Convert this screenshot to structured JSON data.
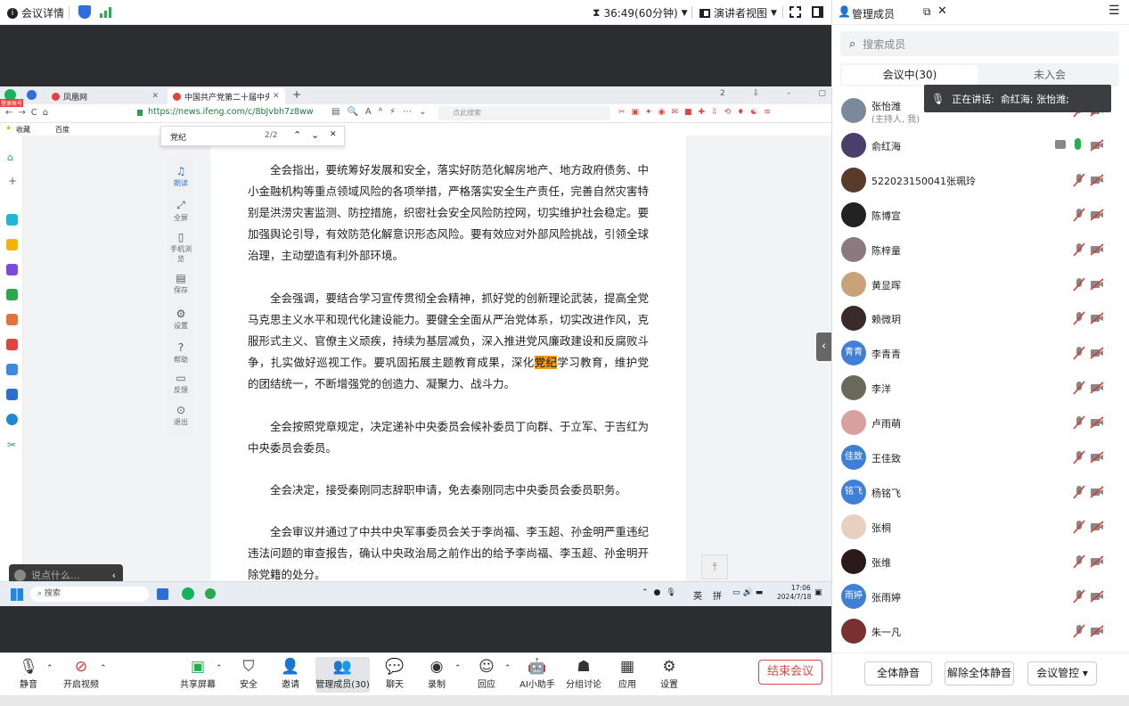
{
  "topbar": {
    "meeting_details": "会议详情",
    "timer": "36:49(60分钟)",
    "view_mode": "演讲者视图"
  },
  "panel": {
    "title": "管理成员",
    "search_placeholder": "搜索成员",
    "tab_in": "会议中(30)",
    "tab_out": "未入会",
    "speaking": "正在讲话:  俞红海; 张怡潍;",
    "host_role": "(主持人, 我)",
    "members": [
      {
        "name": "张怡潍",
        "avatar_text": "",
        "color": "#7a8a9a"
      },
      {
        "name": "俞红海",
        "avatar_text": "",
        "color": "#4a3f6b"
      },
      {
        "name": "522023150041张珮玲",
        "avatar_text": "",
        "color": "#5a3a2a"
      },
      {
        "name": "陈博宣",
        "avatar_text": "",
        "color": "#222222"
      },
      {
        "name": "陈梓童",
        "avatar_text": "",
        "color": "#8a7a80"
      },
      {
        "name": "黄显晖",
        "avatar_text": "",
        "color": "#c9a27a"
      },
      {
        "name": "赖微玥",
        "avatar_text": "",
        "color": "#3a2a2a"
      },
      {
        "name": "李青青",
        "avatar_text": "青青",
        "color": "#3d7fd9"
      },
      {
        "name": "李洋",
        "avatar_text": "",
        "color": "#6a6a5a"
      },
      {
        "name": "卢雨萌",
        "avatar_text": "",
        "color": "#d9a0a0"
      },
      {
        "name": "王佳致",
        "avatar_text": "佳致",
        "color": "#3d7fd9"
      },
      {
        "name": "杨铭飞",
        "avatar_text": "铭飞",
        "color": "#3d7fd9"
      },
      {
        "name": "张桐",
        "avatar_text": "",
        "color": "#e8d0c0"
      },
      {
        "name": "张维",
        "avatar_text": "",
        "color": "#2a1a1a"
      },
      {
        "name": "张雨婷",
        "avatar_text": "雨婷",
        "color": "#3d7fd9"
      },
      {
        "name": "朱一凡",
        "avatar_text": "",
        "color": "#7a3030"
      }
    ],
    "mute_all": "全体静音",
    "unmute_all": "解除全体静音",
    "control": "会议管控"
  },
  "browser": {
    "tab1": "凤凰网",
    "tab2": "中国共产党第二十届中央委员",
    "url": "https://news.ifeng.com/c/8bJvbh7z8ww",
    "search_placeholder": "点此搜索",
    "login_badge": "登录账号",
    "bookmark1": "收藏",
    "bookmark2": "百度",
    "find_text": "党纪",
    "find_count": "2/2"
  },
  "reader_tools": [
    "朗读",
    "全屏",
    "手机浏览",
    "保存",
    "设置",
    "帮助",
    "反馈",
    "退出"
  ],
  "article": {
    "p1": "全会指出，要统筹好发展和安全，落实好防范化解房地产、地方政府债务、中小金融机构等重点领域风险的各项举措，严格落实安全生产责任，完善自然灾害特别是洪涝灾害监测、防控措施，织密社会安全风险防控网，切实维护社会稳定。要加强舆论引导，有效防范化解意识形态风险。要有效应对外部风险挑战，引领全球治理，主动塑造有利外部环境。",
    "p2a": "全会强调，要结合学习宣传贯彻全会精神，抓好党的创新理论武装，提高全党马克思主义水平和现代化建设能力。要健全全面从严治党体系，切实改进作风，克服形式主义、官僚主义顽疾，持续为基层减负，深入推进党风廉政建设和反腐败斗争，扎实做好巡视工作。要巩固拓展主题教育成果，深化",
    "p2hl": "党纪",
    "p2b": "学习教育，维护党的团结统一，不断增强党的创造力、凝聚力、战斗力。",
    "p3": "全会按照党章规定，决定递补中央委员会候补委员丁向群、于立军、于吉红为中央委员会委员。",
    "p4": "全会决定，接受秦刚同志辞职申请，免去秦刚同志中央委员会委员职务。",
    "p5": "全会审议并通过了中共中央军事委员会关于李尚福、李玉超、孙金明严重违纪违法问题的审查报告，确认中央政治局之前作出的给予李尚福、李玉超、孙金明开除党籍的处分。"
  },
  "chat_placeholder": "说点什么...",
  "taskbar": {
    "search": "搜索",
    "ime1": "英",
    "ime2": "拼",
    "time": "17:06",
    "date": "2024/7/18"
  },
  "toolbar": {
    "mute": "静音",
    "video": "开启视频",
    "share": "共享屏幕",
    "security": "安全",
    "invite": "邀请",
    "members": "管理成员(30)",
    "chat": "聊天",
    "record": "录制",
    "react": "回应",
    "ai": "AI小助手",
    "breakout": "分组讨论",
    "apps": "应用",
    "settings": "设置",
    "end": "结束会议"
  }
}
